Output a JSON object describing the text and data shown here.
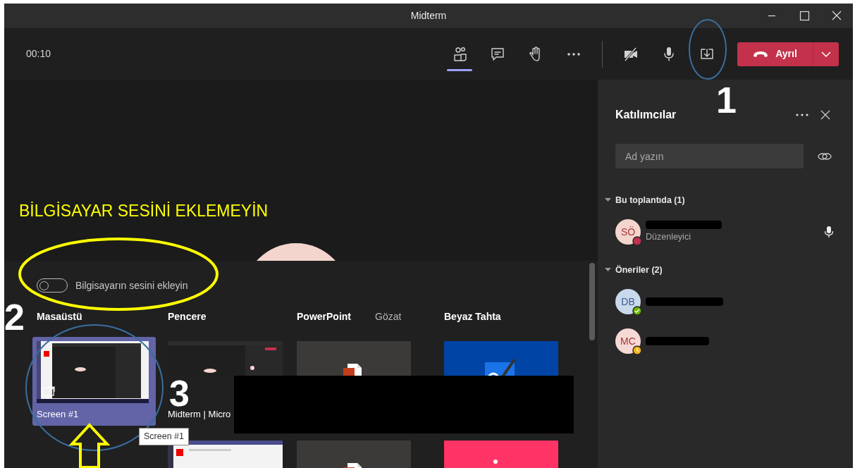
{
  "window": {
    "title": "Midterm"
  },
  "toolbar": {
    "timer": "00:10",
    "view_controls": [
      {
        "kind": "people",
        "selected": true
      },
      {
        "kind": "chat",
        "selected": false
      },
      {
        "kind": "hand",
        "selected": false
      },
      {
        "kind": "more",
        "selected": false
      }
    ],
    "device_controls": [
      {
        "kind": "camera_off"
      },
      {
        "kind": "mic"
      },
      {
        "kind": "share"
      }
    ],
    "leave": {
      "label": "Ayrıl"
    }
  },
  "stage": {
    "note": "BİLGİSAYAR SESİNİ EKLEMEYİN"
  },
  "share_tray": {
    "toggle": {
      "label": "Bilgisayarın sesini ekleyin",
      "on": false
    },
    "sections": [
      {
        "title": "Masaüstü",
        "tiles": [
          {
            "kind": "screen",
            "caption": "Screen #1",
            "selected": true
          }
        ]
      },
      {
        "title": "Pencere",
        "tiles": [
          {
            "kind": "window",
            "caption": "Midterm | Micro",
            "selected": false
          },
          {
            "kind": "browser",
            "selected": false
          }
        ]
      },
      {
        "title": "PowerPoint",
        "browse": "Gözat",
        "tiles": [
          {
            "kind": "file",
            "selected": false
          },
          {
            "kind": "file",
            "selected": false
          }
        ]
      },
      {
        "title": "Beyaz Tahta",
        "tiles": [
          {
            "kind": "whiteboard",
            "selected": false
          },
          {
            "kind": "app",
            "selected": false
          }
        ]
      }
    ],
    "tooltip": "Screen #1"
  },
  "participants": {
    "title": "Katılımcılar",
    "search": {
      "placeholder": "Ad yazın"
    },
    "groups": [
      {
        "title": "Bu toplantıda (1)",
        "expanded": true,
        "people": [
          {
            "avatar": {
              "initials": "SÖ",
              "color": "#f4d5ce"
            },
            "role": "Düzenleyici",
            "status": {
              "kind": "busy",
              "color": "#c4314b"
            },
            "mic": true
          }
        ]
      },
      {
        "title": "Öneriler (2)",
        "expanded": true,
        "people": [
          {
            "avatar": {
              "initials": "DB",
              "color": "#c9d9ec"
            },
            "status": {
              "kind": "available",
              "color": "#6bb700"
            },
            "mic": false
          },
          {
            "avatar": {
              "initials": "MC",
              "color": "#f6d9d5"
            },
            "status": {
              "kind": "away",
              "color": "#f8b61b"
            },
            "mic": false
          }
        ]
      }
    ]
  },
  "annotations": {
    "numbers": [
      "1",
      "2",
      "3"
    ]
  }
}
